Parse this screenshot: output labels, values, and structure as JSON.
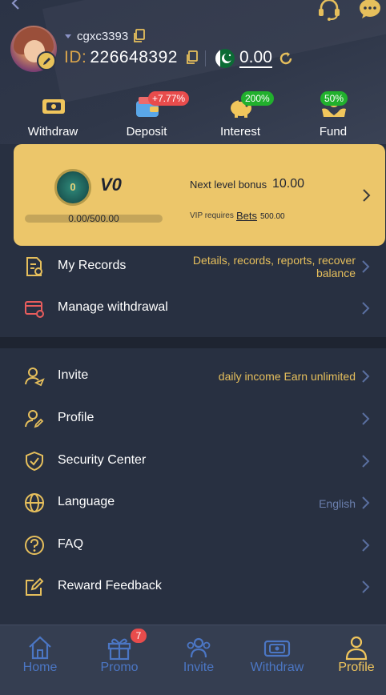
{
  "header": {
    "username": "cgxc3393",
    "id_label": "ID:",
    "id_value": "226648392",
    "balance": "0.00"
  },
  "actions": [
    {
      "label": "Withdraw",
      "badge": ""
    },
    {
      "label": "Deposit",
      "badge": "+7.77%"
    },
    {
      "label": "Interest",
      "badge": "200%"
    },
    {
      "label": "Fund",
      "badge": "50%"
    }
  ],
  "vip": {
    "medal_text": "0",
    "level": "V0",
    "progress_text": "0.00/500.00",
    "progress": 0,
    "next_label": "Next level bonus",
    "next_value": "10.00",
    "requires_label": "VIP requires",
    "bets_label": "Bets",
    "bets_value": "500.00"
  },
  "menu": {
    "my_records": {
      "label": "My Records",
      "extra_line1": "Details, records, reports, recover",
      "extra_line2": "balance"
    },
    "manage_withdrawal": {
      "label": "Manage withdrawal"
    },
    "invite": {
      "label": "Invite",
      "extra": "daily income  Earn unlimited"
    },
    "profile": {
      "label": "Profile"
    },
    "security": {
      "label": "Security Center"
    },
    "language": {
      "label": "Language",
      "extra": "English"
    },
    "faq": {
      "label": "FAQ"
    },
    "feedback": {
      "label": "Reward Feedback"
    }
  },
  "nav": [
    {
      "label": "Home",
      "badge": ""
    },
    {
      "label": "Promo",
      "badge": "7"
    },
    {
      "label": "Invite",
      "badge": ""
    },
    {
      "label": "Withdraw",
      "badge": ""
    },
    {
      "label": "Profile",
      "badge": ""
    }
  ],
  "colors": {
    "accent_gold": "#e6bf5c",
    "vip_card": "#ecc66a",
    "badge_red": "#e84c4c",
    "badge_green": "#21b02d",
    "nav_inactive": "#4b76c4"
  }
}
